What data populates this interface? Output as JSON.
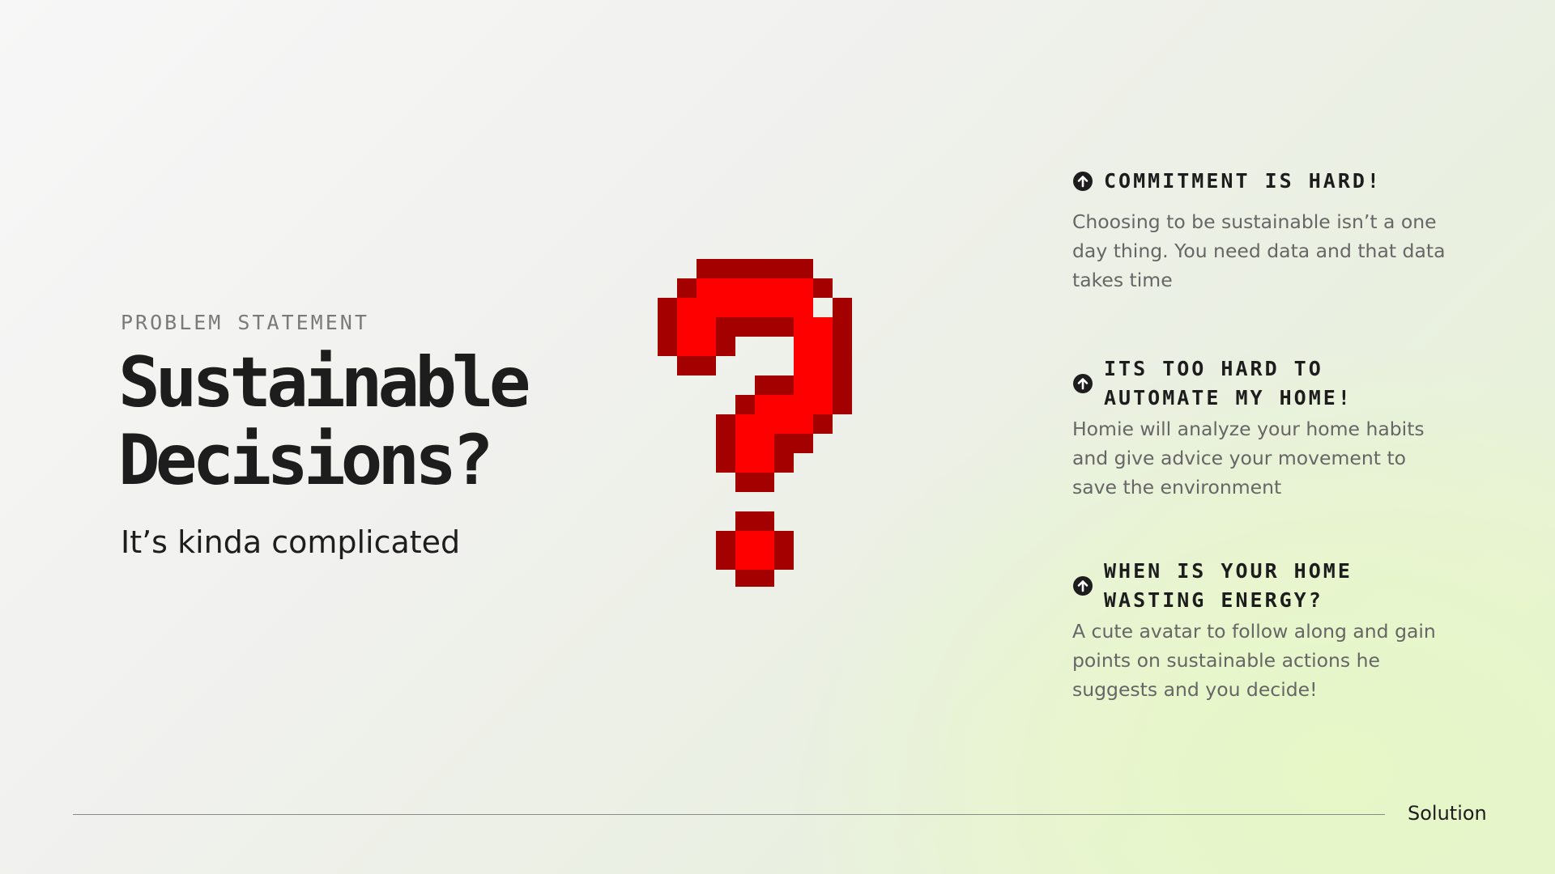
{
  "hero": {
    "kicker": "PROBLEM STATEMENT",
    "title_line1": "Sustainable",
    "title_line2": "Decisions?",
    "subtitle": "It’s kinda complicated"
  },
  "illustration": {
    "icon": "pixel-question-mark-icon",
    "colors": {
      "fill": "#ff0000",
      "shade": "#a50000"
    }
  },
  "features": [
    {
      "icon": "arrow-up-circle-icon",
      "title": "COMMITMENT IS HARD!",
      "body": "Choosing to be sustainable isn’t a one day thing. You need data and that data takes time"
    },
    {
      "icon": "arrow-up-circle-icon",
      "title": "ITS TOO HARD TO\nAUTOMATE MY HOME!",
      "body": "Homie will analyze your home habits and give advice your movement to save the environment"
    },
    {
      "icon": "arrow-up-circle-icon",
      "title": "WHEN IS YOUR HOME\nWASTING ENERGY?",
      "body": "A cute avatar to follow along and gain points on sustainable actions he suggests and you decide!"
    }
  ],
  "footer": {
    "next_label": "Solution"
  }
}
